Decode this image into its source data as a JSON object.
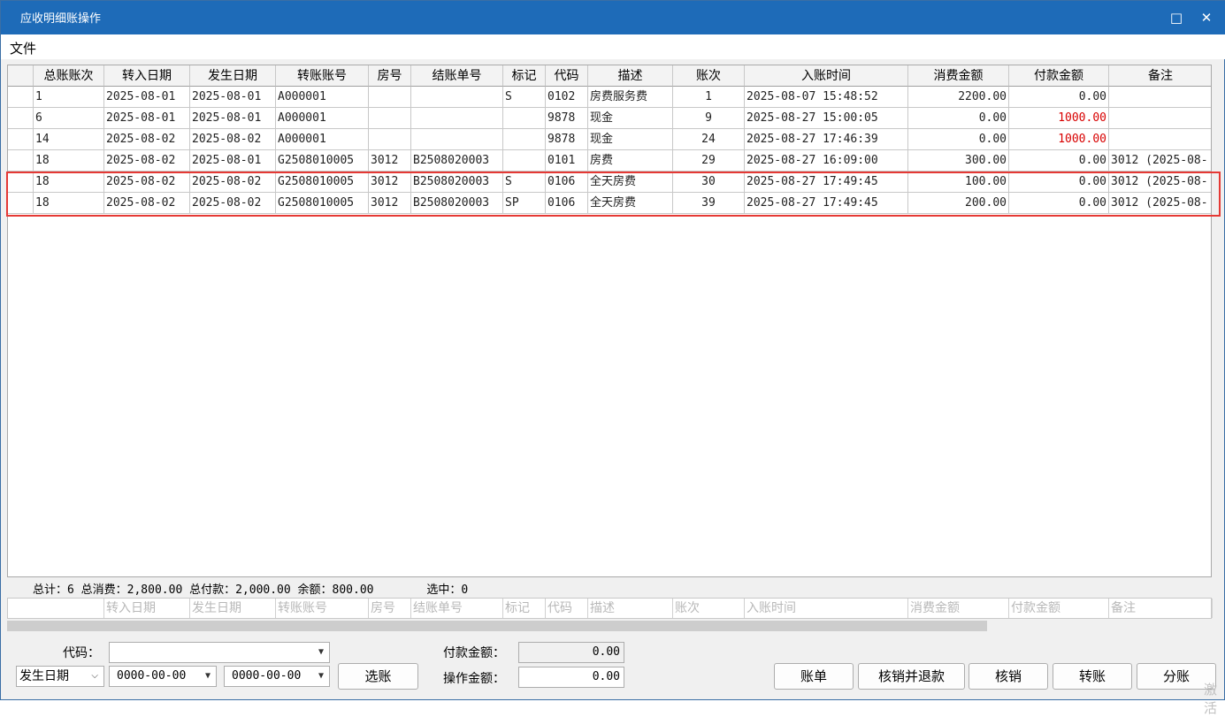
{
  "window": {
    "title": "应收明细账操作",
    "maximize_icon": "□",
    "close_icon": "✕"
  },
  "menu": {
    "file": "文件"
  },
  "table": {
    "headers": [
      "",
      "总账账次",
      "转入日期",
      "发生日期",
      "转账账号",
      "房号",
      "结账单号",
      "标记",
      "代码",
      "描述",
      "账次",
      "入账时间",
      "消费金额",
      "付款金额",
      "备注"
    ],
    "rows": [
      [
        "",
        "1",
        "2025-08-01",
        "2025-08-01",
        "A000001",
        "",
        "",
        "S",
        "0102",
        "房费服务费",
        "1",
        "2025-08-07 15:48:52",
        "2200.00",
        "0.00",
        ""
      ],
      [
        "",
        "6",
        "2025-08-01",
        "2025-08-01",
        "A000001",
        "",
        "",
        "",
        "9878",
        "现金",
        "9",
        "2025-08-27 15:00:05",
        "0.00",
        "1000.00",
        ""
      ],
      [
        "",
        "14",
        "2025-08-02",
        "2025-08-02",
        "A000001",
        "",
        "",
        "",
        "9878",
        "现金",
        "24",
        "2025-08-27 17:46:39",
        "0.00",
        "1000.00",
        ""
      ],
      [
        "",
        "18",
        "2025-08-02",
        "2025-08-01",
        "G2508010005",
        "3012",
        "B2508020003",
        "",
        "0101",
        "房费",
        "29",
        "2025-08-27 16:09:00",
        "300.00",
        "0.00",
        "3012 (2025-08-"
      ],
      [
        "",
        "18",
        "2025-08-02",
        "2025-08-02",
        "G2508010005",
        "3012",
        "B2508020003",
        "S",
        "0106",
        "全天房费",
        "30",
        "2025-08-27 17:49:45",
        "100.00",
        "0.00",
        "3012 (2025-08-"
      ],
      [
        "",
        "18",
        "2025-08-02",
        "2025-08-02",
        "G2508010005",
        "3012",
        "B2508020003",
        "SP",
        "0106",
        "全天房费",
        "39",
        "2025-08-27 17:49:45",
        "200.00",
        "0.00",
        "3012 (2025-08-"
      ]
    ],
    "payment_color": "#d80000"
  },
  "summary": {
    "text": "总计：6 总消费：2,800.00 总付款：2,000.00 余额：800.00",
    "selected": "选中：0"
  },
  "filter_placeholders": [
    "",
    "",
    "转入日期",
    "发生日期",
    "转账账号",
    "房号",
    "结账单号",
    "标记",
    "代码",
    "描述",
    "账次",
    "入账时间",
    "消费金额",
    "付款金额",
    "备注"
  ],
  "controls": {
    "code_label": "代码：",
    "code_value": "",
    "date_type": "发生日期",
    "date_from": "0000-00-00",
    "date_to": "0000-00-00",
    "select_button": "选账",
    "payment_label": "付款金额：",
    "payment_value": "0.00",
    "operate_label": "操作金额：",
    "operate_value": "0.00"
  },
  "buttons": {
    "bill": "账单",
    "writeoff_refund": "核销并退款",
    "writeoff": "核销",
    "transfer": "转账",
    "split": "分账"
  },
  "watermark": "激活"
}
